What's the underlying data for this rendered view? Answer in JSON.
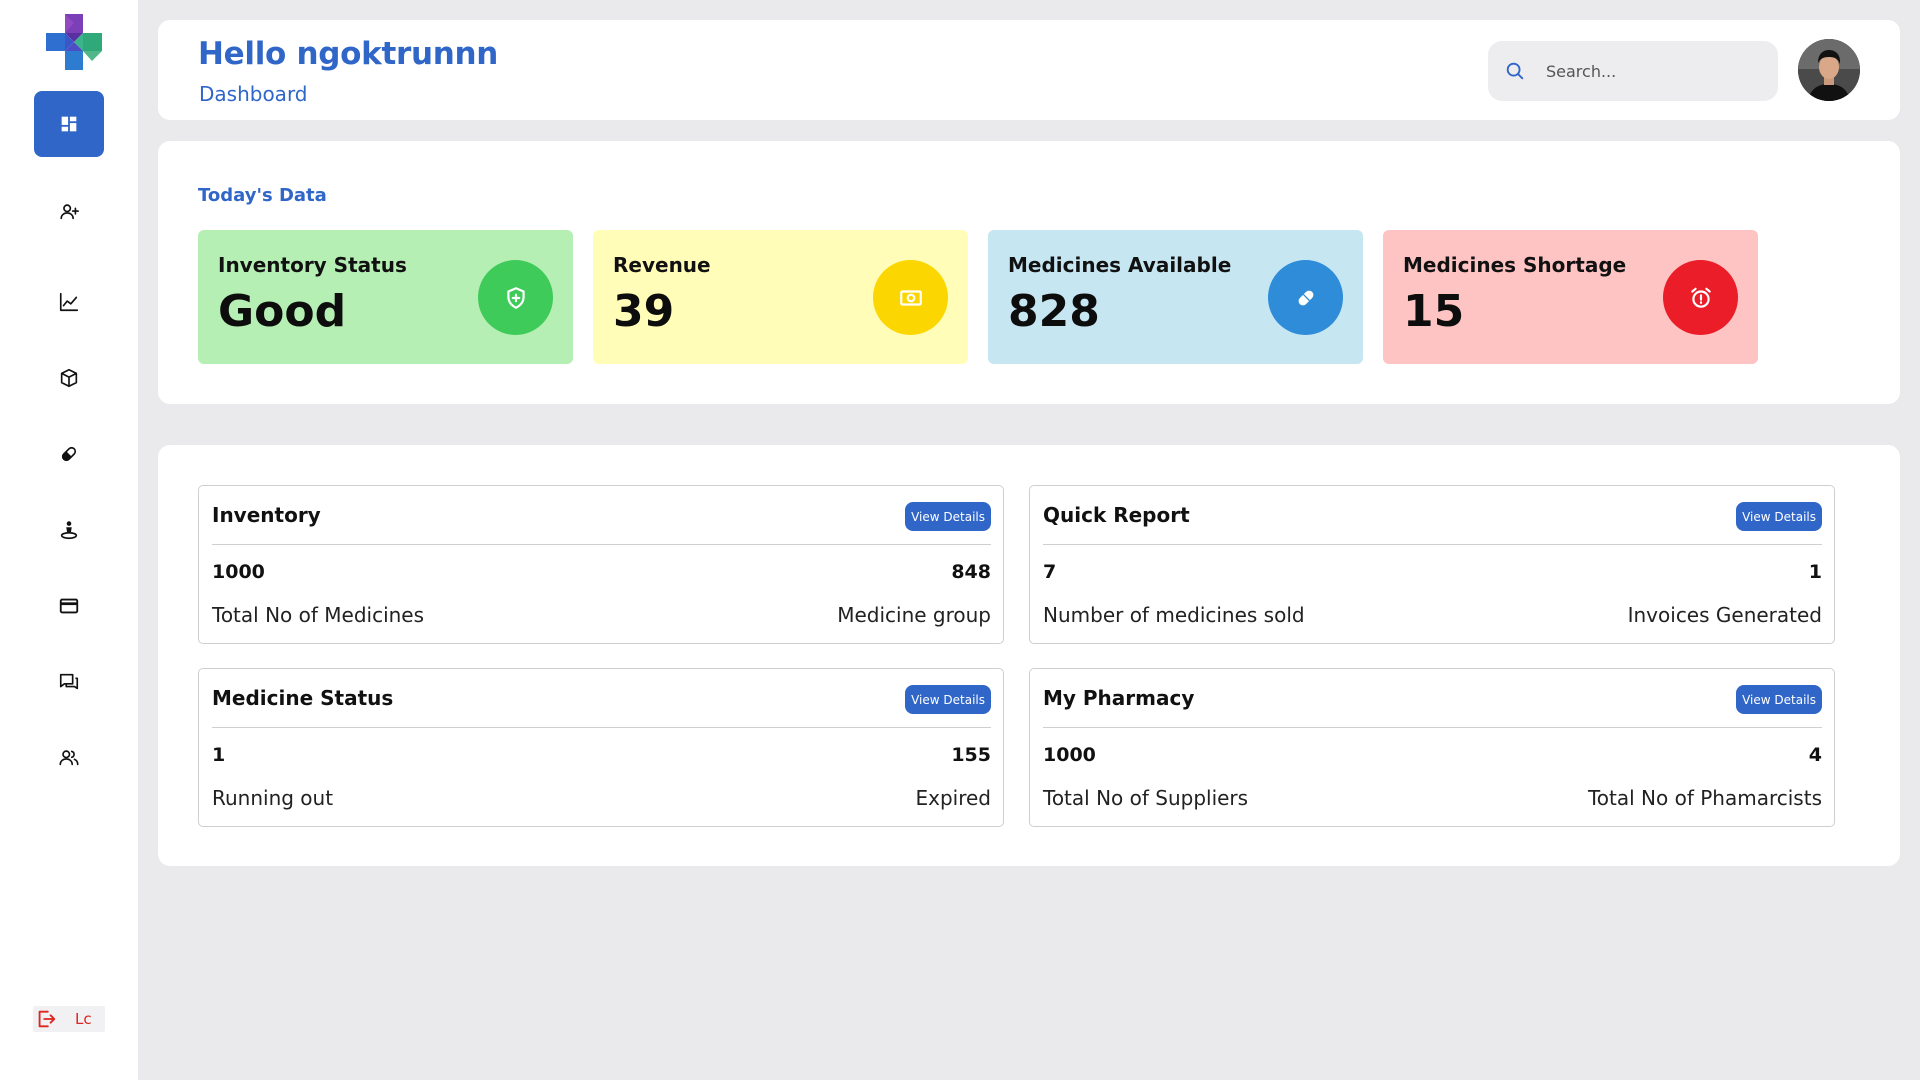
{
  "colors": {
    "brand": "#2F66C8",
    "page_bg": "#EAE9EB",
    "card_inventory": "#B6EFB4",
    "icon_inventory": "#3FCB5A",
    "card_revenue": "#FFFDB8",
    "icon_revenue": "#FCD600",
    "card_medicines": "#C6E6F2",
    "icon_medicines": "#2E8CD8",
    "card_shortage": "#FEC3C3",
    "icon_shortage": "#EA1D28",
    "logout": "#E0241F"
  },
  "sidebar": {
    "logo_icon": "medical-cross-logo",
    "items": [
      {
        "icon": "dashboard-icon",
        "active": true
      },
      {
        "icon": "add-user-icon",
        "active": false
      },
      {
        "icon": "line-chart-icon",
        "active": false
      },
      {
        "icon": "box-icon",
        "active": false
      },
      {
        "icon": "pill-icon",
        "active": false
      },
      {
        "icon": "person-location-icon",
        "active": false
      },
      {
        "icon": "credit-card-icon",
        "active": false
      },
      {
        "icon": "chat-icon",
        "active": false
      },
      {
        "icon": "users-icon",
        "active": false
      }
    ],
    "logout_label": "Lc"
  },
  "header": {
    "greeting": "Hello ngoktrunnn",
    "subtitle": "Dashboard",
    "search_placeholder": "Search..."
  },
  "today": {
    "title": "Today's Data",
    "cards": [
      {
        "label": "Inventory Status",
        "value": "Good",
        "icon": "shield-plus-icon"
      },
      {
        "label": "Revenue",
        "value": "39",
        "icon": "money-icon"
      },
      {
        "label": "Medicines Available",
        "value": "828",
        "icon": "pill-icon"
      },
      {
        "label": "Medicines Shortage",
        "value": "15",
        "icon": "alarm-icon"
      }
    ]
  },
  "details": {
    "button_label": "View Details",
    "cards": [
      {
        "title": "Inventory",
        "left_value": "1000",
        "left_label": "Total No of Medicines",
        "right_value": "848",
        "right_label": "Medicine group"
      },
      {
        "title": "Quick Report",
        "left_value": "7",
        "left_label": "Number of medicines sold",
        "right_value": "1",
        "right_label": "Invoices Generated"
      },
      {
        "title": "Medicine Status",
        "left_value": "1",
        "left_label": "Running out",
        "right_value": "155",
        "right_label": "Expired"
      },
      {
        "title": "My Pharmacy",
        "left_value": "1000",
        "left_label": "Total No of Suppliers",
        "right_value": "4",
        "right_label": "Total No of Phamarcists"
      }
    ]
  }
}
